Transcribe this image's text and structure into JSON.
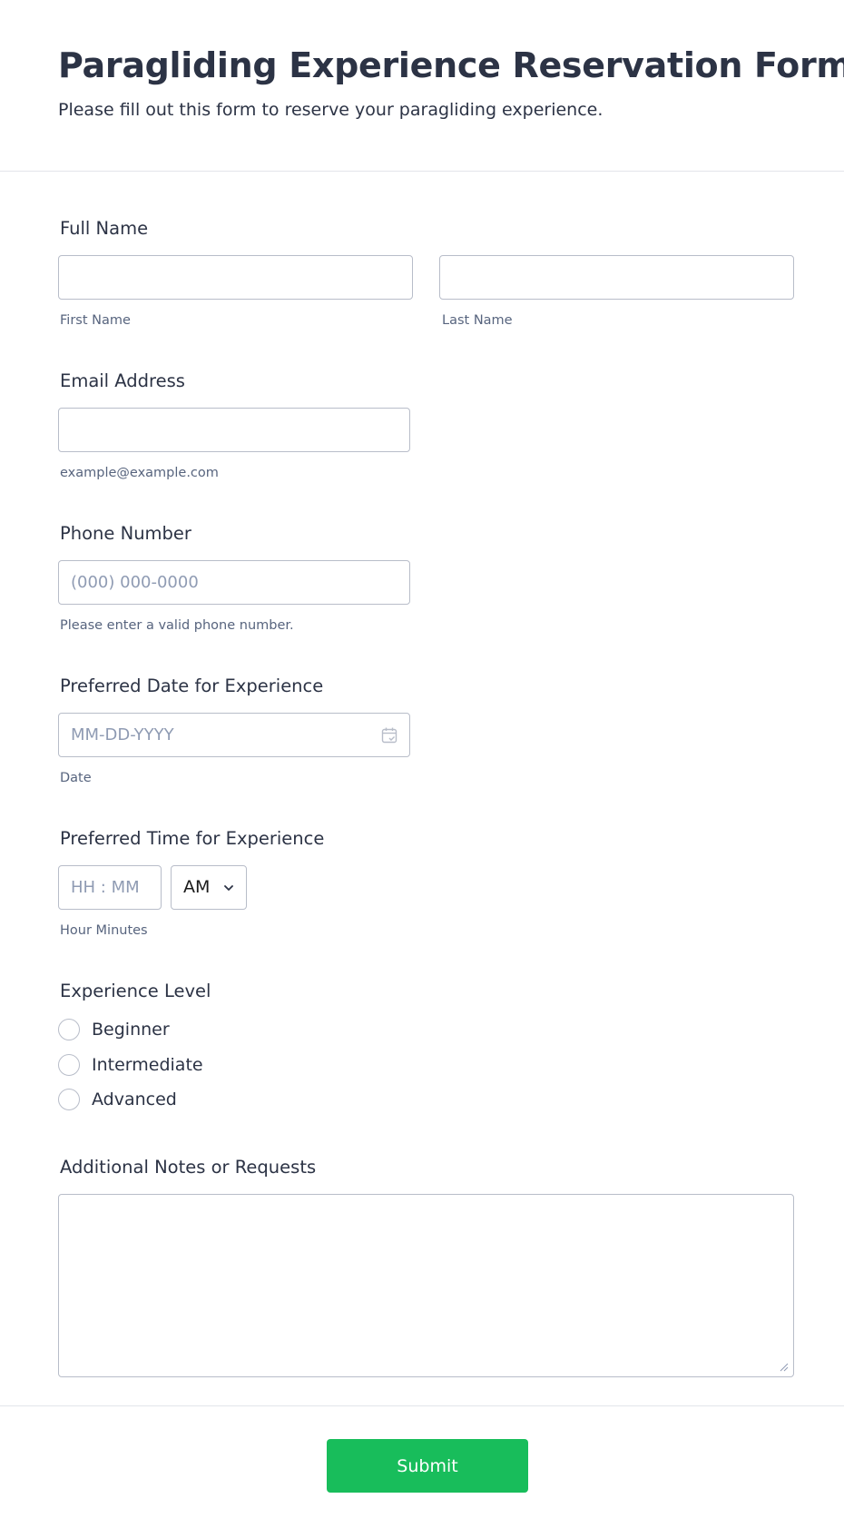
{
  "header": {
    "title": "Paragliding Experience Reservation Form",
    "subtitle": "Please fill out this form to reserve your paragliding experience."
  },
  "full_name": {
    "label": "Full Name",
    "first_value": "",
    "last_value": "",
    "first_sublabel": "First Name",
    "last_sublabel": "Last Name"
  },
  "email": {
    "label": "Email Address",
    "value": "",
    "sublabel": "example@example.com"
  },
  "phone": {
    "label": "Phone Number",
    "placeholder": "(000) 000-0000",
    "sublabel": "Please enter a valid phone number."
  },
  "date": {
    "label": "Preferred Date for Experience",
    "placeholder": "MM-DD-YYYY",
    "sublabel": "Date",
    "icon": "calendar-icon"
  },
  "time": {
    "label": "Preferred Time for Experience",
    "placeholder": "HH : MM",
    "ampm_selected": "AM",
    "sublabel": "Hour Minutes"
  },
  "experience": {
    "label": "Experience Level",
    "options": [
      "Beginner",
      "Intermediate",
      "Advanced"
    ]
  },
  "notes": {
    "label": "Additional Notes or Requests",
    "value": ""
  },
  "submit_label": "Submit",
  "colors": {
    "text": "#2c3345",
    "border": "#b8bdc9",
    "placeholder": "#8f9bb3",
    "submit": "#18bd5b",
    "divider": "#e3e5ea"
  }
}
